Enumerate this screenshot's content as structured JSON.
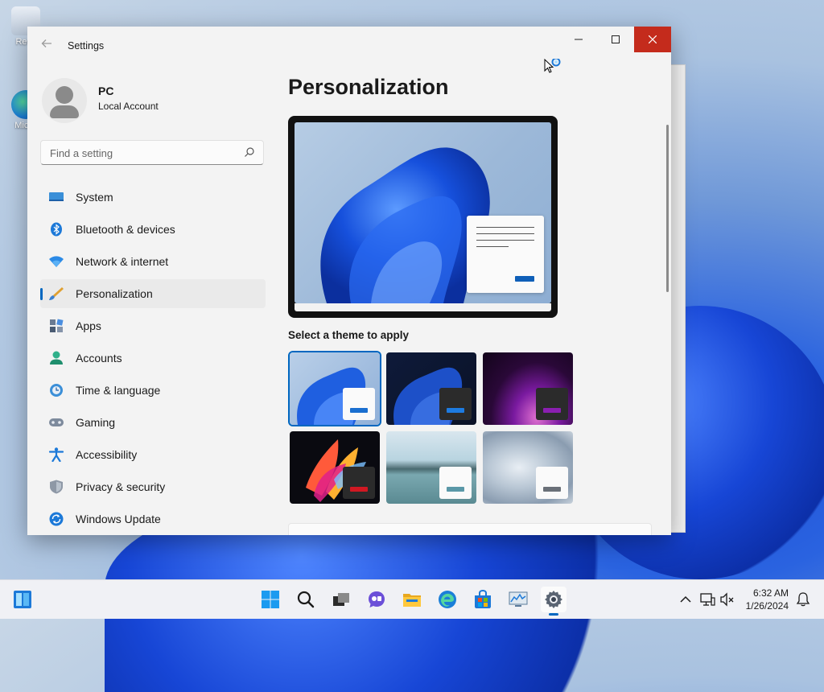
{
  "desktop": {
    "icons": [
      {
        "label": "Recy"
      },
      {
        "label": "Mic E"
      }
    ]
  },
  "window": {
    "title": "Settings",
    "controls": {
      "minimize": "—",
      "maximize": "☐",
      "close": "✕"
    }
  },
  "profile": {
    "name": "PC",
    "account": "Local Account"
  },
  "search": {
    "placeholder": "Find a setting"
  },
  "nav": {
    "items": [
      {
        "label": "System",
        "icon": "system-icon"
      },
      {
        "label": "Bluetooth & devices",
        "icon": "bluetooth-icon"
      },
      {
        "label": "Network & internet",
        "icon": "network-icon"
      },
      {
        "label": "Personalization",
        "icon": "brush-icon",
        "active": true
      },
      {
        "label": "Apps",
        "icon": "apps-icon"
      },
      {
        "label": "Accounts",
        "icon": "accounts-icon"
      },
      {
        "label": "Time & language",
        "icon": "time-language-icon"
      },
      {
        "label": "Gaming",
        "icon": "gaming-icon"
      },
      {
        "label": "Accessibility",
        "icon": "accessibility-icon"
      },
      {
        "label": "Privacy & security",
        "icon": "shield-icon"
      },
      {
        "label": "Windows Update",
        "icon": "windows-update-icon"
      }
    ]
  },
  "main": {
    "title": "Personalization",
    "themes_label": "Select a theme to apply",
    "themes": [
      {
        "name": "windows-light",
        "selected": true,
        "accent": "#1a6fd0"
      },
      {
        "name": "windows-dark",
        "selected": false,
        "accent": "#1d7be0"
      },
      {
        "name": "glow",
        "selected": false,
        "accent": "#8a1fb0"
      },
      {
        "name": "captured-motion",
        "selected": false,
        "accent": "#d01822"
      },
      {
        "name": "sunrise",
        "selected": false,
        "accent": "#5a98a8"
      },
      {
        "name": "flow",
        "selected": false,
        "accent": "#6a7078"
      }
    ]
  },
  "taskbar": {
    "apps": [
      "start-icon",
      "search-icon",
      "task-view-icon",
      "chat-icon",
      "file-explorer-icon",
      "edge-icon",
      "store-icon",
      "monitor-app-icon",
      "settings-icon"
    ],
    "clock": {
      "time": "6:32 AM",
      "date": "1/26/2024"
    }
  },
  "colors": {
    "accent": "#0067c0",
    "close": "#c42b1c"
  }
}
